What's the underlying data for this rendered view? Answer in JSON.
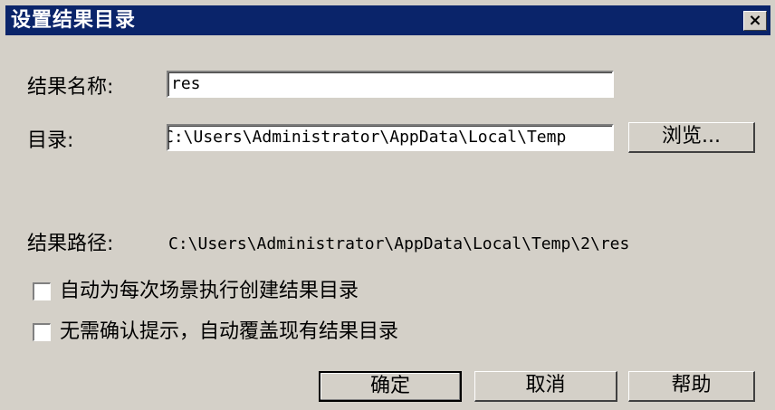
{
  "dialog": {
    "title": "设置结果目录",
    "close_glyph": "×"
  },
  "form": {
    "result_name_label": "结果名称:",
    "result_name_value": "res",
    "directory_label": "目录:",
    "directory_value": "C:\\Users\\Administrator\\AppData\\Local\\Temp",
    "browse_label": "浏览...",
    "result_path_label": "结果路径:",
    "result_path_value": "C:\\Users\\Administrator\\AppData\\Local\\Temp\\2\\res"
  },
  "options": {
    "auto_create_label": "自动为每次场景执行创建结果目录",
    "auto_create_checked": false,
    "overwrite_label": "无需确认提示，自动覆盖现有结果目录",
    "overwrite_checked": false
  },
  "buttons": {
    "ok_label": "确定",
    "cancel_label": "取消",
    "help_label": "帮助"
  }
}
